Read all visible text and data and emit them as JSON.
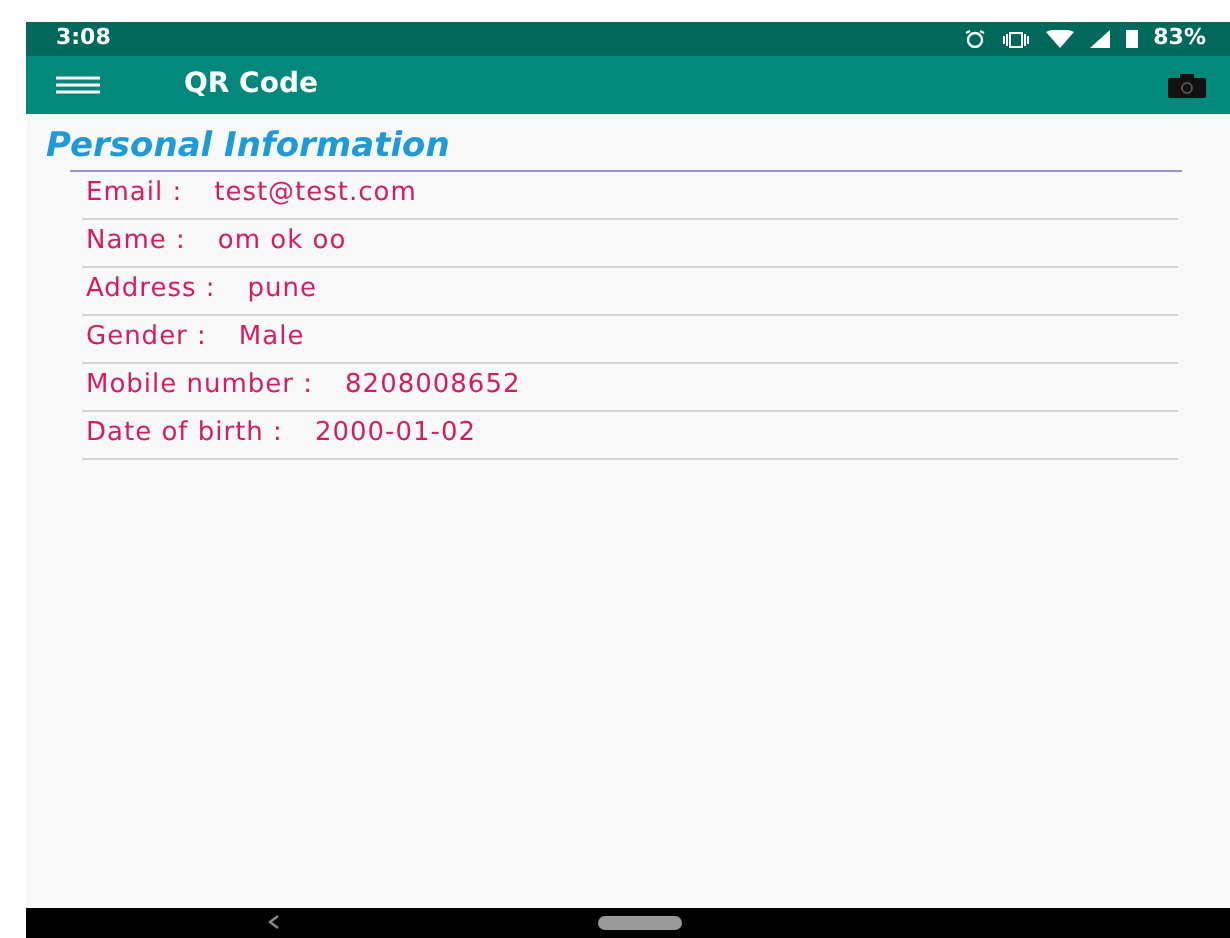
{
  "status_bar": {
    "time": "3:08",
    "battery": "83%"
  },
  "app_bar": {
    "title": "QR Code"
  },
  "section": {
    "title": "Personal Information"
  },
  "fields": [
    {
      "label": "Email :",
      "value": "test@test.com"
    },
    {
      "label": "Name :",
      "value": "om ok oo"
    },
    {
      "label": "Address :",
      "value": "pune"
    },
    {
      "label": "Gender :",
      "value": "Male"
    },
    {
      "label": "Mobile number :",
      "value": "8208008652"
    },
    {
      "label": "Date of birth :",
      "value": "2000-01-02"
    }
  ]
}
